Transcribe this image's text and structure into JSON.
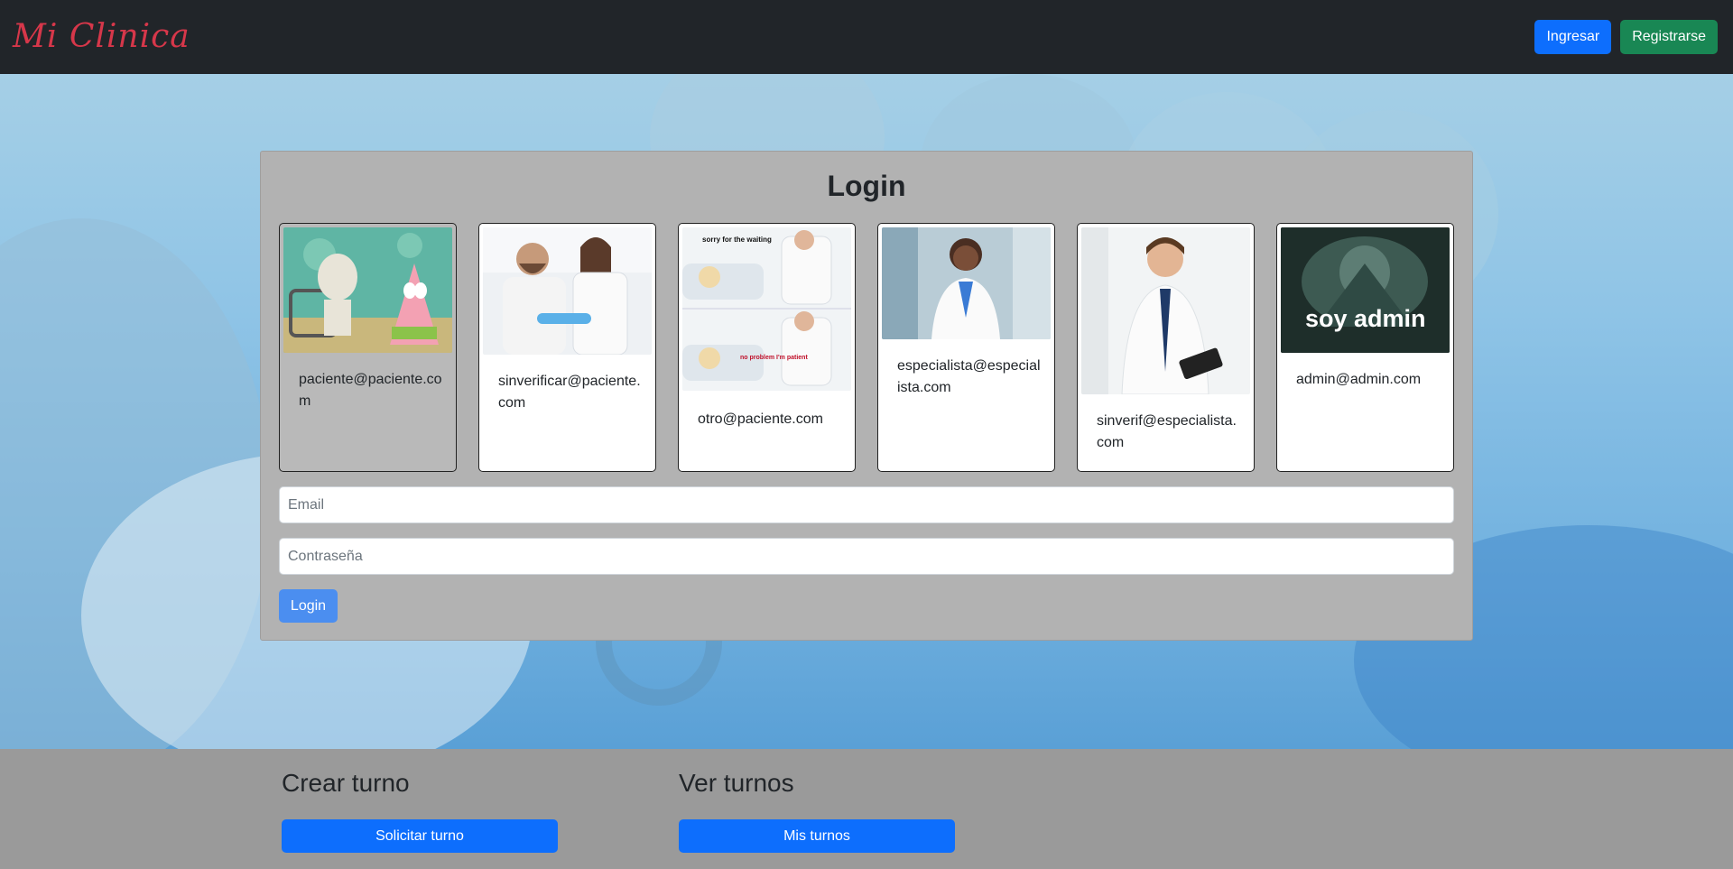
{
  "navbar": {
    "brand": "Mi Clinica",
    "ingresar_label": "Ingresar",
    "registrarse_label": "Registrarse"
  },
  "login": {
    "title": "Login",
    "quick_users": [
      {
        "email": "paciente@paciente.com",
        "image": "spongebob-patient-meme",
        "active": true
      },
      {
        "email": "sinverificar@paciente.com",
        "image": "doctor-bandaging-patient-photo",
        "active": false
      },
      {
        "email": "otro@paciente.com",
        "image": "sorry-for-the-waiting-meme",
        "active": false
      },
      {
        "email": "especialista@especialista.com",
        "image": "female-doctor-photo",
        "active": false
      },
      {
        "email": "sinverif@especialista.com",
        "image": "male-doctor-photo",
        "active": false
      },
      {
        "email": "admin@admin.com",
        "image": "soy-admin-meme",
        "active": false
      }
    ],
    "meme_top": "sorry for the waiting",
    "meme_bottom": "no problem I'm patient",
    "admin_caption": "soy admin",
    "email_placeholder": "Email",
    "password_placeholder": "Contraseña",
    "submit_label": "Login"
  },
  "footer": {
    "crear_title": "Crear turno",
    "crear_button": "Solicitar turno",
    "ver_title": "Ver turnos",
    "ver_button": "Mis turnos"
  },
  "colors": {
    "navbar": "#212529",
    "brand": "#d6374a",
    "primary": "#0d6efd",
    "success": "#198754",
    "card_bg": "#b2b2b2"
  }
}
